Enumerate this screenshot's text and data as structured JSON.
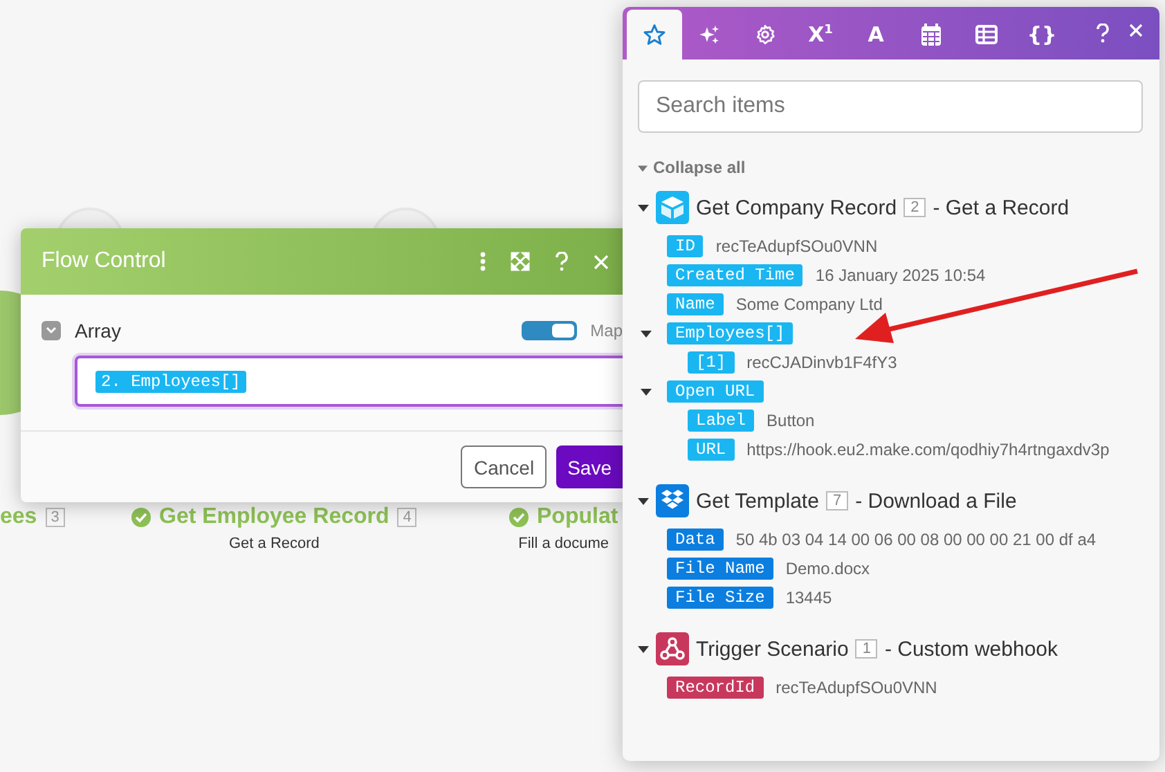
{
  "canvas": {
    "nodes": [
      {
        "title": "ees",
        "number": "3"
      },
      {
        "title": "Get Employee Record",
        "number": "4",
        "subtitle": "Get a Record",
        "checked": true
      },
      {
        "title": "Populat",
        "subtitle": "Fill a docume",
        "checked": true
      }
    ]
  },
  "dialog": {
    "title": "Flow Control",
    "field": {
      "label": "Array",
      "expanded": true,
      "map_on": true,
      "map_label": "Map",
      "token": "2. Employees[]"
    },
    "buttons": [
      {
        "label": "Cancel",
        "kind": "secondary"
      },
      {
        "label": "Save",
        "kind": "primary"
      }
    ]
  },
  "panel": {
    "tabs": [
      {
        "kind": "star",
        "selected": true
      },
      {
        "kind": "sparkle",
        "selected": false
      },
      {
        "kind": "gear",
        "selected": false
      },
      {
        "kind": "text",
        "label": "X$^{1}$",
        "selected": false
      },
      {
        "kind": "text",
        "label": "A",
        "selected": false
      },
      {
        "kind": "calendar",
        "selected": false
      },
      {
        "kind": "table",
        "selected": false
      },
      {
        "kind": "text",
        "label": "{}",
        "selected": false
      }
    ],
    "search": {
      "placeholder": "Search items"
    },
    "collapse_all": "Collapse all",
    "modules": [
      {
        "title": "Get Company Record",
        "number": "2",
        "action": "- Get a Record",
        "color": "#1ab6f2",
        "expanded": true,
        "items": [
          {
            "label": "ID",
            "value": "recTeAdupfSOu0VNN"
          },
          {
            "label": "Created Time",
            "value": "16 January 2025 10:54"
          },
          {
            "label": "Name",
            "value": "Some Company Ltd"
          },
          {
            "label": "Employees[]",
            "expanded": true,
            "children": [
              {
                "label": "[1]",
                "value": "recCJADinvb1F4fY3"
              }
            ]
          },
          {
            "label": "Open URL",
            "expanded": true,
            "children": [
              {
                "label": "Label",
                "value": "Button"
              },
              {
                "label": "URL",
                "value": "https://hook.eu2.make.com/qodhiy7h4rtngaxdv3p"
              }
            ]
          }
        ]
      },
      {
        "title": "Get Template",
        "number": "7",
        "action": "- Download a File",
        "color": "#0b7ee0",
        "expanded": true,
        "items": [
          {
            "label": "Data",
            "value": "50 4b 03 04 14 00 06 00 08 00 00 00 21 00 df a4"
          },
          {
            "label": "File Name",
            "value": "Demo.docx"
          },
          {
            "label": "File Size",
            "value": "13445"
          }
        ]
      },
      {
        "title": "Trigger Scenario",
        "number": "1",
        "action": "- Custom webhook",
        "color": "#c8385d",
        "expanded": true,
        "items": [
          {
            "label": "RecordId",
            "value": "recTeAdupfSOu0VNN"
          }
        ]
      }
    ]
  }
}
